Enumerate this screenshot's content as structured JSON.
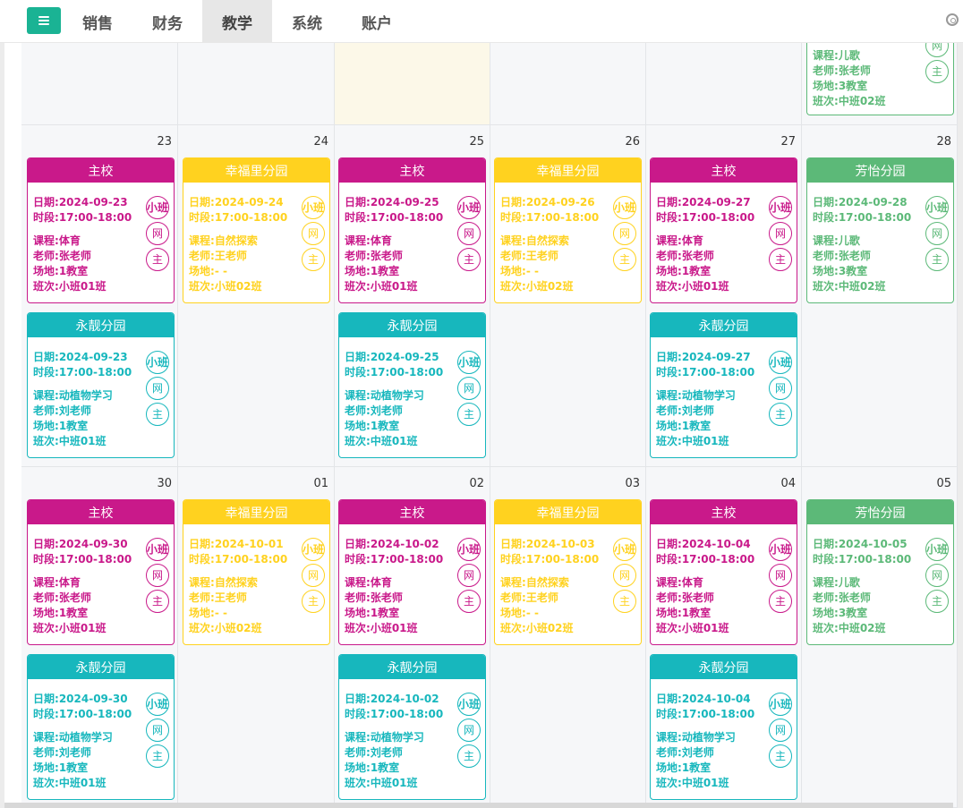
{
  "nav": {
    "menu_icon": "hamburger-icon",
    "items": [
      {
        "label": "销售",
        "active": false
      },
      {
        "label": "财务",
        "active": false
      },
      {
        "label": "教学",
        "active": true
      },
      {
        "label": "系统",
        "active": false
      },
      {
        "label": "账户",
        "active": false
      }
    ],
    "settings_icon": "settings-icon"
  },
  "colors": {
    "main": "#c9198a",
    "xingfu": "#ffd21f",
    "yongjing": "#17b7bd",
    "fangyi": "#5cb978",
    "accent": "#1ab394"
  },
  "labels": {
    "date": "日期:",
    "time": "时段:",
    "course": "课程:",
    "teacher": "老师:",
    "room": "场地:",
    "class": "班次:"
  },
  "tags": [
    "小班",
    "网",
    "主"
  ],
  "prev_week_card": {
    "course": "儿歌",
    "teacher": "张老师",
    "room": "3教室",
    "class": "中班02班"
  },
  "weeks": [
    {
      "days": [
        {
          "num": "23",
          "cards": [
            {
              "campus": "主校",
              "color": "main",
              "date": "2024-09-23",
              "time": "17:00-18:00",
              "course": "体育",
              "teacher": "张老师",
              "room": "1教室",
              "class": "小班01班"
            },
            {
              "campus": "永靓分园",
              "color": "yongjing",
              "date": "2024-09-23",
              "time": "17:00-18:00",
              "course": "动植物学习",
              "teacher": "刘老师",
              "room": "1教室",
              "class": "中班01班"
            }
          ]
        },
        {
          "num": "24",
          "cards": [
            {
              "campus": "幸福里分园",
              "color": "xingfu",
              "date": "2024-09-24",
              "time": "17:00-18:00",
              "course": "自然探索",
              "teacher": "王老师",
              "room": "- -",
              "class": "小班02班"
            }
          ]
        },
        {
          "num": "25",
          "cards": [
            {
              "campus": "主校",
              "color": "main",
              "date": "2024-09-25",
              "time": "17:00-18:00",
              "course": "体育",
              "teacher": "张老师",
              "room": "1教室",
              "class": "小班01班"
            },
            {
              "campus": "永靓分园",
              "color": "yongjing",
              "date": "2024-09-25",
              "time": "17:00-18:00",
              "course": "动植物学习",
              "teacher": "刘老师",
              "room": "1教室",
              "class": "中班01班"
            }
          ]
        },
        {
          "num": "26",
          "cards": [
            {
              "campus": "幸福里分园",
              "color": "xingfu",
              "date": "2024-09-26",
              "time": "17:00-18:00",
              "course": "自然探索",
              "teacher": "王老师",
              "room": "- -",
              "class": "小班02班"
            }
          ]
        },
        {
          "num": "27",
          "cards": [
            {
              "campus": "主校",
              "color": "main",
              "date": "2024-09-27",
              "time": "17:00-18:00",
              "course": "体育",
              "teacher": "张老师",
              "room": "1教室",
              "class": "小班01班"
            },
            {
              "campus": "永靓分园",
              "color": "yongjing",
              "date": "2024-09-27",
              "time": "17:00-18:00",
              "course": "动植物学习",
              "teacher": "刘老师",
              "room": "1教室",
              "class": "中班01班"
            }
          ]
        },
        {
          "num": "28",
          "cards": [
            {
              "campus": "芳怡分园",
              "color": "fangyi",
              "date": "2024-09-28",
              "time": "17:00-18:00",
              "course": "儿歌",
              "teacher": "张老师",
              "room": "3教室",
              "class": "中班02班"
            }
          ]
        }
      ]
    },
    {
      "days": [
        {
          "num": "30",
          "cards": [
            {
              "campus": "主校",
              "color": "main",
              "date": "2024-09-30",
              "time": "17:00-18:00",
              "course": "体育",
              "teacher": "张老师",
              "room": "1教室",
              "class": "小班01班"
            },
            {
              "campus": "永靓分园",
              "color": "yongjing",
              "date": "2024-09-30",
              "time": "17:00-18:00",
              "course": "动植物学习",
              "teacher": "刘老师",
              "room": "1教室",
              "class": "中班01班"
            }
          ]
        },
        {
          "num": "01",
          "cards": [
            {
              "campus": "幸福里分园",
              "color": "xingfu",
              "date": "2024-10-01",
              "time": "17:00-18:00",
              "course": "自然探索",
              "teacher": "王老师",
              "room": "- -",
              "class": "小班02班"
            }
          ]
        },
        {
          "num": "02",
          "cards": [
            {
              "campus": "主校",
              "color": "main",
              "date": "2024-10-02",
              "time": "17:00-18:00",
              "course": "体育",
              "teacher": "张老师",
              "room": "1教室",
              "class": "小班01班"
            },
            {
              "campus": "永靓分园",
              "color": "yongjing",
              "date": "2024-10-02",
              "time": "17:00-18:00",
              "course": "动植物学习",
              "teacher": "刘老师",
              "room": "1教室",
              "class": "中班01班"
            }
          ]
        },
        {
          "num": "03",
          "cards": [
            {
              "campus": "幸福里分园",
              "color": "xingfu",
              "date": "2024-10-03",
              "time": "17:00-18:00",
              "course": "自然探索",
              "teacher": "王老师",
              "room": "- -",
              "class": "小班02班"
            }
          ]
        },
        {
          "num": "04",
          "cards": [
            {
              "campus": "主校",
              "color": "main",
              "date": "2024-10-04",
              "time": "17:00-18:00",
              "course": "体育",
              "teacher": "张老师",
              "room": "1教室",
              "class": "小班01班"
            },
            {
              "campus": "永靓分园",
              "color": "yongjing",
              "date": "2024-10-04",
              "time": "17:00-18:00",
              "course": "动植物学习",
              "teacher": "刘老师",
              "room": "1教室",
              "class": "中班01班"
            }
          ]
        },
        {
          "num": "05",
          "cards": [
            {
              "campus": "芳怡分园",
              "color": "fangyi",
              "date": "2024-10-05",
              "time": "17:00-18:00",
              "course": "儿歌",
              "teacher": "张老师",
              "room": "3教室",
              "class": "中班02班"
            }
          ]
        }
      ]
    }
  ]
}
